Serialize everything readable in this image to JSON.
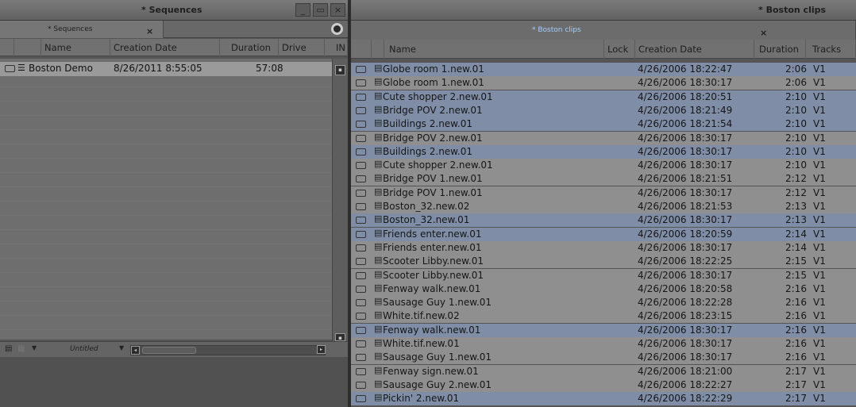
{
  "left_panel": {
    "title": "* Sequences",
    "window_buttons": [
      "_",
      "▭",
      "×"
    ],
    "tab_label": "* Sequences",
    "tab_close": "×",
    "columns": [
      "Name",
      "Creation Date",
      "Duration",
      "Drive",
      "IN"
    ],
    "rows": [
      {
        "name": "Boston Demo",
        "date": "8/26/2011 8:55:05",
        "duration": "57:08"
      }
    ],
    "footer_view": "Untitled"
  },
  "right_panel": {
    "title": "* Boston clips",
    "tab_label": "* Boston clips",
    "tab_close": "×",
    "columns": [
      "Name",
      "Lock",
      "Creation Date",
      "Duration",
      "Tracks"
    ],
    "rows": [
      {
        "name": "Globe room 1.new.01",
        "date": "4/26/2006 18:22:47",
        "duration": "2:06",
        "tracks": "V1",
        "selected": true
      },
      {
        "name": "Globe room 1.new.01",
        "date": "4/26/2006 18:30:17",
        "duration": "2:06",
        "tracks": "V1",
        "selected": false
      },
      {
        "name": "Cute shopper 2.new.01",
        "date": "4/26/2006 18:20:51",
        "duration": "2:10",
        "tracks": "V1",
        "selected": true
      },
      {
        "name": "Bridge POV 2.new.01",
        "date": "4/26/2006 18:21:49",
        "duration": "2:10",
        "tracks": "V1",
        "selected": true
      },
      {
        "name": "Buildings 2.new.01",
        "date": "4/26/2006 18:21:54",
        "duration": "2:10",
        "tracks": "V1",
        "selected": true
      },
      {
        "name": "Bridge POV 2.new.01",
        "date": "4/26/2006 18:30:17",
        "duration": "2:10",
        "tracks": "V1",
        "selected": false
      },
      {
        "name": "Buildings 2.new.01",
        "date": "4/26/2006 18:30:17",
        "duration": "2:10",
        "tracks": "V1",
        "selected": true
      },
      {
        "name": "Cute shopper 2.new.01",
        "date": "4/26/2006 18:30:17",
        "duration": "2:10",
        "tracks": "V1",
        "selected": false
      },
      {
        "name": "Bridge POV 1.new.01",
        "date": "4/26/2006 18:21:51",
        "duration": "2:12",
        "tracks": "V1",
        "selected": false
      },
      {
        "name": "Bridge POV 1.new.01",
        "date": "4/26/2006 18:30:17",
        "duration": "2:12",
        "tracks": "V1",
        "selected": false
      },
      {
        "name": "Boston_32.new.02",
        "date": "4/26/2006 18:21:53",
        "duration": "2:13",
        "tracks": "V1",
        "selected": false
      },
      {
        "name": "Boston_32.new.01",
        "date": "4/26/2006 18:30:17",
        "duration": "2:13",
        "tracks": "V1",
        "selected": true
      },
      {
        "name": "Friends enter.new.01",
        "date": "4/26/2006 18:20:59",
        "duration": "2:14",
        "tracks": "V1",
        "selected": true
      },
      {
        "name": "Friends enter.new.01",
        "date": "4/26/2006 18:30:17",
        "duration": "2:14",
        "tracks": "V1",
        "selected": false
      },
      {
        "name": "Scooter Libby.new.01",
        "date": "4/26/2006 18:22:25",
        "duration": "2:15",
        "tracks": "V1",
        "selected": false
      },
      {
        "name": "Scooter Libby.new.01",
        "date": "4/26/2006 18:30:17",
        "duration": "2:15",
        "tracks": "V1",
        "selected": false
      },
      {
        "name": "Fenway walk.new.01",
        "date": "4/26/2006 18:20:58",
        "duration": "2:16",
        "tracks": "V1",
        "selected": false
      },
      {
        "name": "Sausage Guy 1.new.01",
        "date": "4/26/2006 18:22:28",
        "duration": "2:16",
        "tracks": "V1",
        "selected": false
      },
      {
        "name": "White.tif.new.02",
        "date": "4/26/2006 18:23:15",
        "duration": "2:16",
        "tracks": "V1",
        "selected": false
      },
      {
        "name": "Fenway walk.new.01",
        "date": "4/26/2006 18:30:17",
        "duration": "2:16",
        "tracks": "V1",
        "selected": true
      },
      {
        "name": "White.tif.new.01",
        "date": "4/26/2006 18:30:17",
        "duration": "2:16",
        "tracks": "V1",
        "selected": false
      },
      {
        "name": "Sausage Guy 1.new.01",
        "date": "4/26/2006 18:30:17",
        "duration": "2:16",
        "tracks": "V1",
        "selected": false
      },
      {
        "name": "Fenway sign.new.01",
        "date": "4/26/2006 18:21:00",
        "duration": "2:17",
        "tracks": "V1",
        "selected": false
      },
      {
        "name": "Sausage Guy 2.new.01",
        "date": "4/26/2006 18:22:27",
        "duration": "2:17",
        "tracks": "V1",
        "selected": false
      },
      {
        "name": "Pickin' 2.new.01",
        "date": "4/26/2006 18:22:29",
        "duration": "2:17",
        "tracks": "V1",
        "selected": true
      }
    ]
  },
  "colors": {
    "selected_row": "#7f8ea6",
    "row": "#8f8f8f",
    "active_tab_text": "#9fd0ff"
  },
  "icons": {
    "clip_icon": "clip-icon",
    "sequence_icon": "sequence-icon",
    "gear_icon": "gear-icon"
  }
}
